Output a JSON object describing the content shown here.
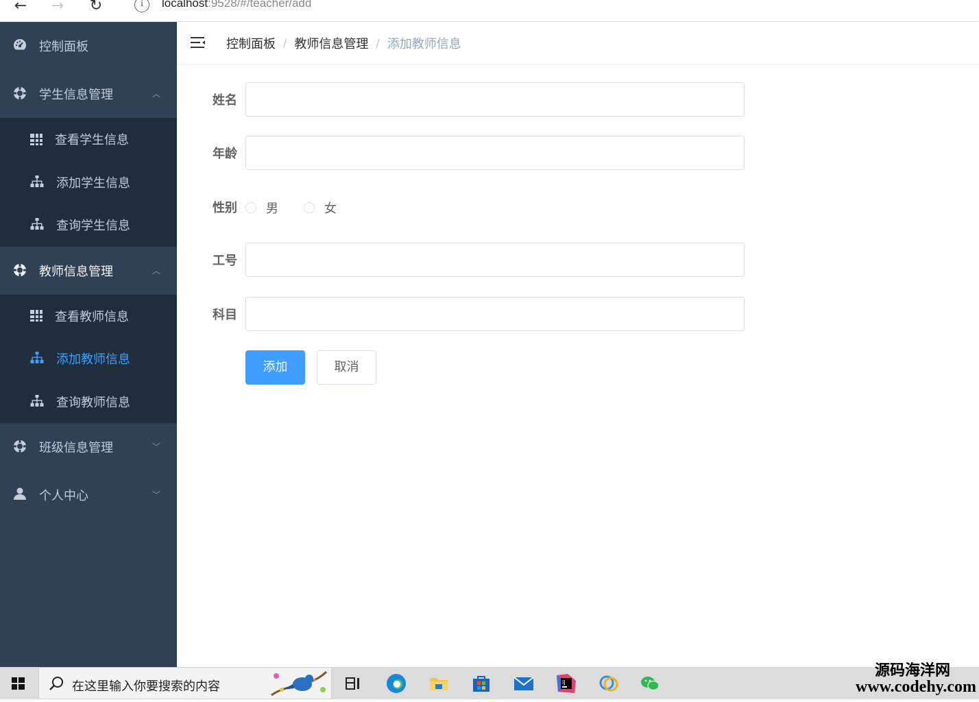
{
  "browser": {
    "url_host": "localhost",
    "url_path": ":9528/#/teacher/add",
    "info_glyph": "i",
    "back_glyph": "←",
    "forward_glyph": "→",
    "reload_glyph": "↻"
  },
  "sidebar": {
    "items": [
      {
        "label": "控制面板",
        "icon": "dashboard-icon"
      },
      {
        "label": "学生信息管理",
        "icon": "student-icon",
        "expanded": true,
        "children": [
          {
            "label": "查看学生信息",
            "icon": "table-icon"
          },
          {
            "label": "添加学生信息",
            "icon": "tree-icon"
          },
          {
            "label": "查询学生信息",
            "icon": "tree-icon"
          }
        ]
      },
      {
        "label": "教师信息管理",
        "icon": "teacher-icon",
        "expanded": true,
        "children": [
          {
            "label": "查看教师信息",
            "icon": "table-icon"
          },
          {
            "label": "添加教师信息",
            "icon": "tree-icon",
            "active": true
          },
          {
            "label": "查询教师信息",
            "icon": "tree-icon"
          }
        ]
      },
      {
        "label": "班级信息管理",
        "icon": "class-icon",
        "expanded": false
      },
      {
        "label": "个人中心",
        "icon": "user-icon",
        "expanded": false
      }
    ],
    "arrow_up": "︿",
    "arrow_down": "﹀"
  },
  "breadcrumb": {
    "items": [
      "控制面板",
      "教师信息管理",
      "添加教师信息"
    ],
    "separator": "/"
  },
  "form": {
    "name_label": "姓名",
    "name_value": "",
    "age_label": "年龄",
    "age_value": "",
    "gender_label": "性别",
    "gender_options": [
      "男",
      "女"
    ],
    "gender_selected": null,
    "id_label": "工号",
    "id_value": "",
    "subject_label": "科目",
    "subject_value": "",
    "submit_label": "添加",
    "cancel_label": "取消"
  },
  "taskbar": {
    "search_placeholder": "在这里输入你要搜索的内容",
    "icons": [
      "windows-start-icon",
      "search-icon",
      "task-view-icon",
      "edge-icon",
      "file-explorer-icon",
      "store-icon",
      "mail-icon",
      "intellij-icon",
      "chrome-like-icon",
      "wechat-icon"
    ]
  },
  "watermark": {
    "cn": "源码海洋网",
    "en": "www.codehy.com"
  },
  "colors": {
    "sidebar_bg": "#304156",
    "submenu_bg": "#1f2d3d",
    "accent": "#409eff",
    "menu_text": "#bfcbd9"
  }
}
